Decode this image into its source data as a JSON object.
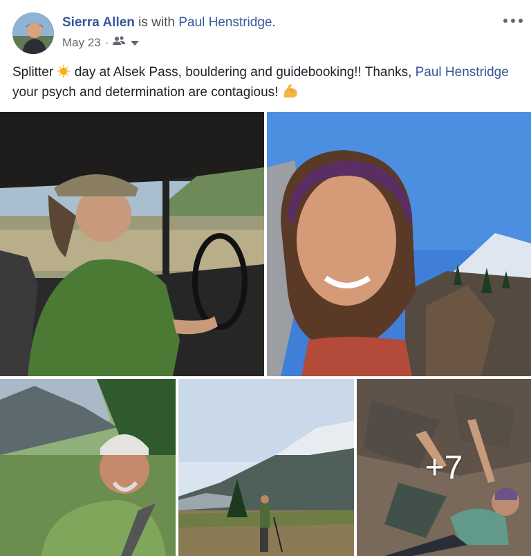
{
  "post": {
    "author": "Sierra Allen",
    "with_text": " is with ",
    "tagged": "Paul Henstridge",
    "tagged_suffix": ".",
    "date": "May 23",
    "date_separator": "·",
    "audience_icon": "friends-icon",
    "more_icon": "more-options-icon",
    "text_part1": "Splitter ",
    "text_part2": " day at Alsek Pass, bouldering and guidebooking!! Thanks, ",
    "text_mention": "Paul Henstridge",
    "text_part3": " your psych and determination are contagious! ",
    "emoji_sun": "sun-emoji",
    "emoji_arm": "flexed-biceps-emoji"
  },
  "photos": {
    "more_count": "+7",
    "items": [
      "photo-man-driving",
      "photo-woman-selfie",
      "photo-man-smiling",
      "photo-hiker-valley",
      "photo-woman-climbing"
    ]
  },
  "colors": {
    "link": "#385898",
    "meta": "#606770"
  }
}
